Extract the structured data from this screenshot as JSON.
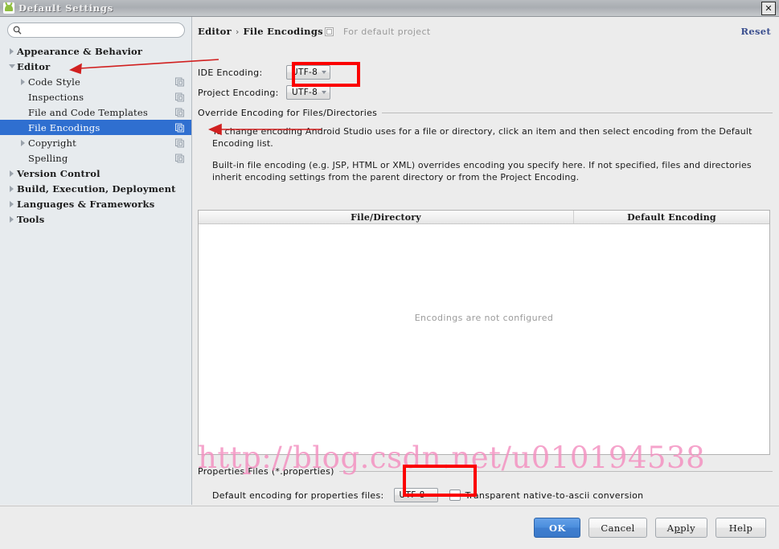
{
  "window": {
    "title": "Default Settings",
    "app_icon": "android-studio-icon",
    "close_label": "✕"
  },
  "sidebar": {
    "search": {
      "value": "",
      "placeholder": "",
      "icon": "search-icon"
    },
    "items": [
      {
        "label": "Appearance & Behavior",
        "depth": 0,
        "twisty": "right",
        "bold": true,
        "copy_icon": false,
        "selected": false
      },
      {
        "label": "Editor",
        "depth": 0,
        "twisty": "down",
        "bold": true,
        "copy_icon": false,
        "selected": false
      },
      {
        "label": "Code Style",
        "depth": 1,
        "twisty": "right",
        "bold": false,
        "copy_icon": true,
        "selected": false
      },
      {
        "label": "Inspections",
        "depth": 1,
        "twisty": "none",
        "bold": false,
        "copy_icon": true,
        "selected": false
      },
      {
        "label": "File and Code Templates",
        "depth": 1,
        "twisty": "none",
        "bold": false,
        "copy_icon": true,
        "selected": false
      },
      {
        "label": "File Encodings",
        "depth": 1,
        "twisty": "none",
        "bold": false,
        "copy_icon": true,
        "selected": true
      },
      {
        "label": "Copyright",
        "depth": 1,
        "twisty": "right",
        "bold": false,
        "copy_icon": true,
        "selected": false
      },
      {
        "label": "Spelling",
        "depth": 1,
        "twisty": "none",
        "bold": false,
        "copy_icon": true,
        "selected": false
      },
      {
        "label": "Version Control",
        "depth": 0,
        "twisty": "right",
        "bold": true,
        "copy_icon": false,
        "selected": false
      },
      {
        "label": "Build, Execution, Deployment",
        "depth": 0,
        "twisty": "right",
        "bold": true,
        "copy_icon": false,
        "selected": false
      },
      {
        "label": "Languages & Frameworks",
        "depth": 0,
        "twisty": "right",
        "bold": true,
        "copy_icon": false,
        "selected": false
      },
      {
        "label": "Tools",
        "depth": 0,
        "twisty": "right",
        "bold": true,
        "copy_icon": false,
        "selected": false
      }
    ]
  },
  "content": {
    "breadcrumb": {
      "parent": "Editor",
      "separator": "›",
      "current": "File Encodings",
      "note": "For default project",
      "note_icon": "project-scope-icon"
    },
    "reset_label": "Reset",
    "ide_encoding": {
      "label": "IDE Encoding:",
      "value": "UTF-8"
    },
    "project_encoding": {
      "label": "Project Encoding:",
      "value": "UTF-8"
    },
    "override_section_title": "Override Encoding for Files/Directories",
    "description": [
      "To change encoding Android Studio uses for a file or directory, click an item and then select encoding from the Default Encoding list.",
      "Built-in file encoding (e.g. JSP, HTML or XML) overrides encoding you specify here. If not specified, files and directories inherit encoding settings from the parent directory or from the Project Encoding."
    ],
    "table": {
      "columns": [
        "File/Directory",
        "Default Encoding"
      ],
      "rows": [],
      "empty_message": "Encodings are not configured"
    },
    "properties_section_title": "Properties Files (*.properties)",
    "properties_encoding": {
      "label": "Default encoding for properties files:",
      "value": "UTF-8"
    },
    "transparent_checkbox": {
      "label": "Transparent native-to-ascii conversion",
      "checked": false
    }
  },
  "buttons": {
    "ok": "OK",
    "cancel": "Cancel",
    "apply_pre": "A",
    "apply_mnemonic": "p",
    "apply_post": "ply",
    "apply": "Apply",
    "help": "Help"
  },
  "annotations": {
    "watermark_text": "http://blog.csdn.net/u010194538",
    "highlight_color": "#fb0000",
    "watermark_color": "#f48fc0"
  }
}
